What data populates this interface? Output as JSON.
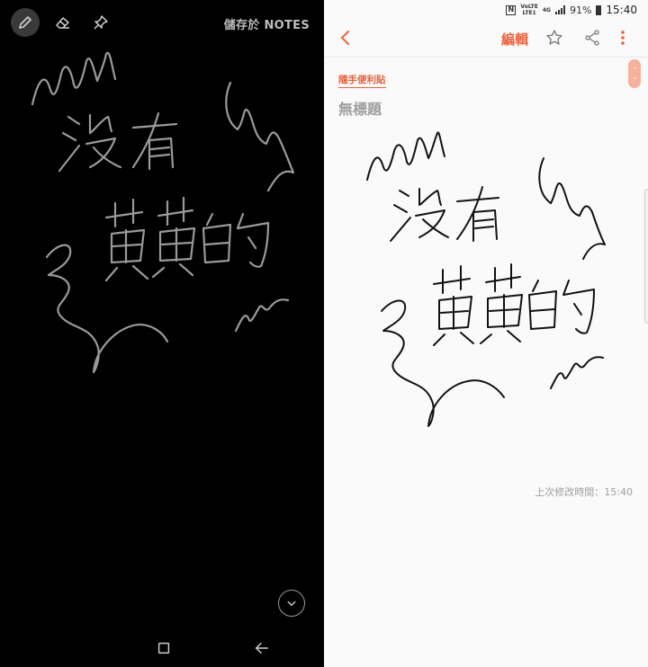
{
  "screen_off_memo": {
    "save_label": "儲存於 NOTES",
    "toolbar_icons": [
      "pen-icon",
      "eraser-icon",
      "pin-icon"
    ],
    "collapse_icon": "chevron-down-icon",
    "nav_icons": [
      "recents-icon",
      "back-arrow-icon"
    ]
  },
  "notes_app": {
    "status_bar": {
      "network_small_top": "VoLTE",
      "network_small_bottom": "LTE1",
      "network_type": "4G",
      "battery_percent": "91%",
      "time": "15:40"
    },
    "toolbar": {
      "edit_label": "編輯",
      "icons": [
        "back-chevron-icon",
        "star-icon",
        "share-icon",
        "more-vert-icon"
      ]
    },
    "category_label": "隨手便利貼",
    "note_title": "無標題",
    "last_modified": "上次修改時間：15:40"
  },
  "colors": {
    "accent": "#f0613d",
    "left_background": "#000000",
    "right_background": "#fafafa",
    "ink_left": "#9a9a9a",
    "ink_right": "#111111"
  }
}
